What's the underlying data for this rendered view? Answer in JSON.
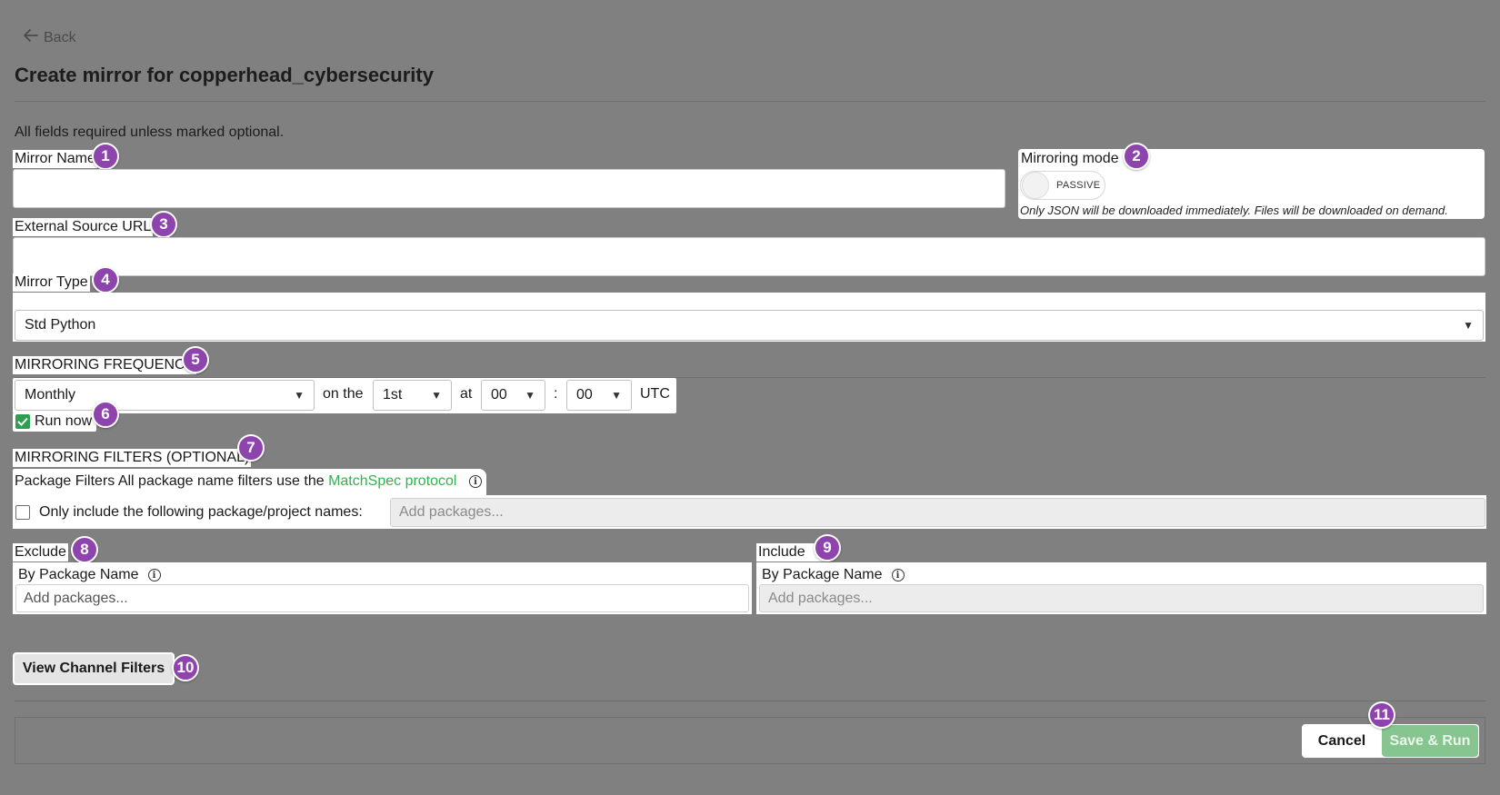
{
  "nav": {
    "back_label": "Back"
  },
  "page": {
    "title": "Create mirror for copperhead_cybersecurity",
    "required_note": "All fields required unless marked optional."
  },
  "badges": [
    "1",
    "2",
    "3",
    "4",
    "5",
    "6",
    "7",
    "8",
    "9",
    "10",
    "11"
  ],
  "mirror_name": {
    "label": "Mirror Name",
    "value": ""
  },
  "mirroring_mode": {
    "label": "Mirroring mode",
    "toggle_text": "PASSIVE",
    "help": "Only JSON will be downloaded immediately. Files will be downloaded on demand."
  },
  "external_source": {
    "label": "External Source URL",
    "value": ""
  },
  "mirror_type": {
    "label": "Mirror Type",
    "selected": "Std Python"
  },
  "frequency": {
    "heading": "MIRRORING FREQUENCY",
    "period": "Monthly",
    "on_the": "on the",
    "day": "1st",
    "at": "at",
    "hour": "00",
    "colon": ":",
    "minute": "00",
    "tz": "UTC"
  },
  "run_now": {
    "label": "Run now",
    "checked": true
  },
  "filters": {
    "heading": "MIRRORING FILTERS (OPTIONAL)",
    "package_filters_label": "Package Filters",
    "package_filters_desc": "All package name filters use the",
    "matchspec_link": "MatchSpec protocol",
    "only_include_label": "Only include the following package/project names:",
    "only_include_placeholder": "Add packages...",
    "exclude": {
      "label": "Exclude",
      "by_label": "By Package Name",
      "placeholder": "Add packages..."
    },
    "include": {
      "label": "Include",
      "by_label": "By Package Name",
      "placeholder": "Add packages..."
    }
  },
  "channel_filters_button": "View Channel Filters",
  "footer": {
    "cancel_label": "Cancel",
    "save_label": "Save & Run"
  },
  "colors": {
    "accent_green": "#2fb34a",
    "badge_purple": "#8e44ad",
    "overlay_gray": "#808080"
  }
}
